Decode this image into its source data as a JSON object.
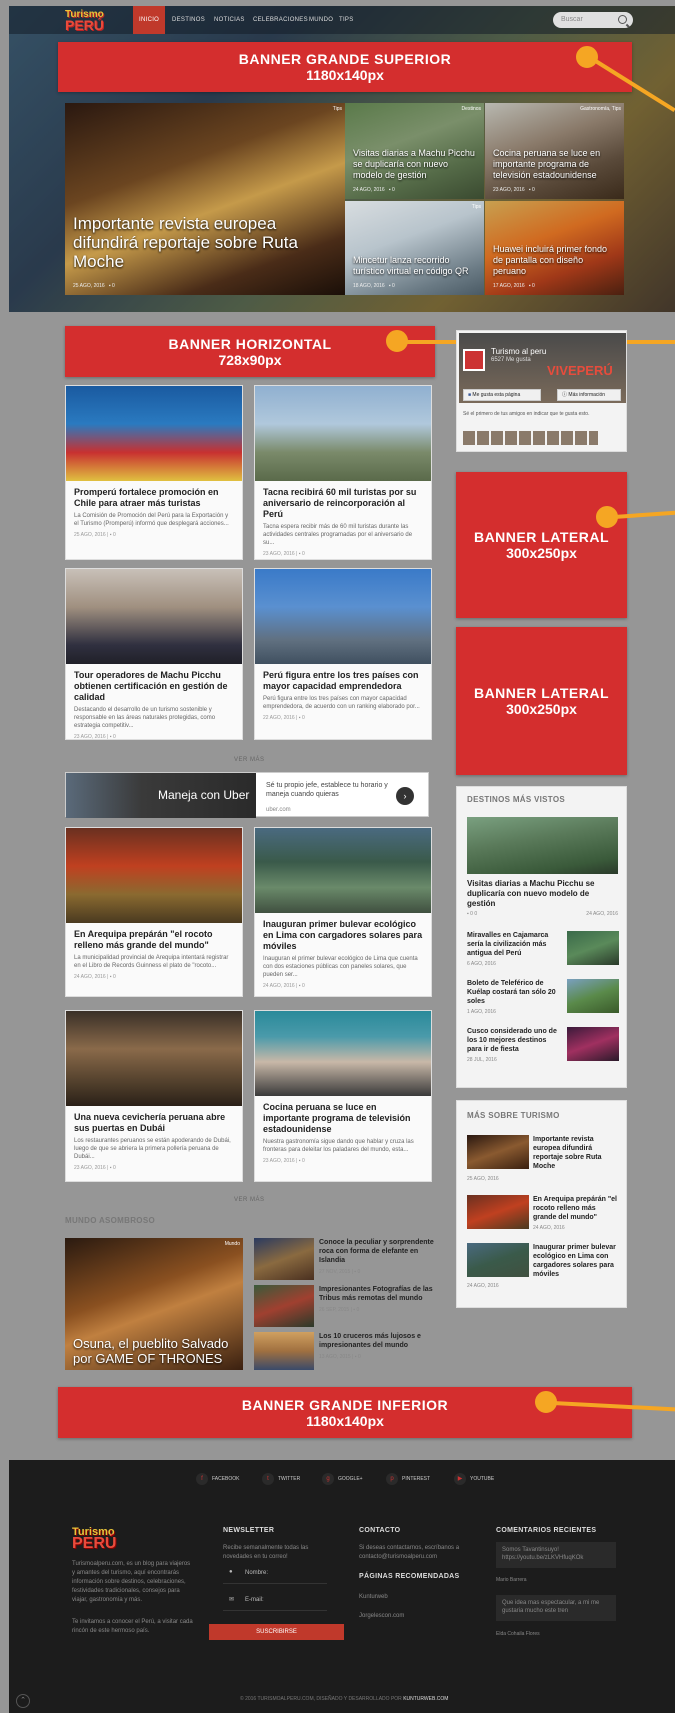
{
  "logo": {
    "line1": "Turismo",
    "line2": "PERÚ"
  },
  "nav": {
    "items": [
      "INICIO",
      "DESTINOS",
      "NOTICIAS",
      "CELEBRACIONES",
      "MUNDO",
      "TIPS"
    ],
    "search_placeholder": "Buscar"
  },
  "banners": {
    "top": {
      "l1": "BANNER  GRANDE SUPERIOR",
      "l2": "1180x140px"
    },
    "horizontal": {
      "l1": "BANNER  HORIZONTAL",
      "l2": "728x90px"
    },
    "lateral1": {
      "l1": "BANNER  LATERAL",
      "l2": "300x250px"
    },
    "lateral2": {
      "l1": "BANNER  LATERAL",
      "l2": "300x250px"
    },
    "bottom": {
      "l1": "BANNER  GRANDE INFERIOR",
      "l2": "1180x140px"
    }
  },
  "featured": [
    {
      "tag": "Tips",
      "title": "Importante revista europea difundirá reportaje sobre Ruta Moche",
      "date": "25 AGO, 2016",
      "comments": "0"
    },
    {
      "tag": "Destinos",
      "title": "Visitas diarias a Machu Picchu se duplicaría con nuevo modelo de gestión",
      "date": "24 AGO, 2016",
      "comments": "0"
    },
    {
      "tag": "Gastronomía, Tips",
      "title": "Cocina peruana se luce en importante programa de televisión estadounidense",
      "date": "23 AGO, 2016",
      "comments": "0"
    },
    {
      "tag": "Tips",
      "title": "Mincetur lanza recorrido turístico virtual en código QR",
      "date": "18 AGO, 2016",
      "comments": "0"
    },
    {
      "tag": "",
      "title": "Huawei incluirá primer fondo de pantalla con diseño peruano",
      "date": "17 AGO, 2016",
      "comments": "0"
    }
  ],
  "cards": [
    {
      "tag": "Noticias",
      "title": "Promperú fortalece promoción en Chile para atraer más turistas",
      "desc": "La Comisión de Promoción del Perú para la Exportación y el Turismo (Promperú) informó que desplegará acciones...",
      "date": "25 AGO, 2016",
      "comments": "0"
    },
    {
      "tag": "Noticias",
      "title": "Tacna recibirá 60 mil turistas por su aniversario de reincorporación al Perú",
      "desc": "Tacna espera recibir más de 60 mil turistas durante las actividades centrales programadas por el aniversario de su...",
      "date": "23 AGO, 2016",
      "comments": "0"
    },
    {
      "tag": "",
      "title": "Tour operadores de Machu Picchu obtienen certificación en gestión de calidad",
      "desc": "Destacando el desarrollo de un turismo sostenible y responsable en las áreas naturales protegidas, como estrategia competitiv...",
      "date": "23 AGO, 2016",
      "comments": "0"
    },
    {
      "tag": "Noticias",
      "title": "Perú figura entre los tres países con mayor capacidad emprendedora",
      "desc": "Perú figura entre los tres países con mayor capacidad emprendedora, de acuerdo con un ranking elaborado por...",
      "date": "22 AGO, 2016",
      "comments": "0"
    },
    {
      "tag": "Gastronomía",
      "title": "En Arequipa prepárán \"el rocoto relleno más grande del mundo\"",
      "desc": "La municipalidad provincial de Arequipa intentará registrar en el Libro de Records Guinness el plato de \"rocoto...",
      "date": "24 AGO, 2016",
      "comments": "0"
    },
    {
      "tag": "Noticias",
      "title": "Inauguran primer bulevar ecológico en Lima con cargadores solares para móviles",
      "desc": "Inauguran el primer bulevar ecológico de Lima que cuenta con dos estaciones públicas con paneles solares, que pueden ser...",
      "date": "24 AGO, 2016",
      "comments": "0"
    },
    {
      "tag": "",
      "title": "Una nueva cevichería peruana abre sus puertas en Dubái",
      "desc": "Los restaurantes peruanos se están apoderando de Dubái, luego de que se abriera la primera pollería peruana de Dubái...",
      "date": "23 AGO, 2016",
      "comments": "0"
    },
    {
      "tag": "Gastronomía, Tips",
      "title": "Cocina peruana se luce en importante programa de televisión estadounidense",
      "desc": "Nuestra gastronomía sigue dando que hablar y cruza las fronteras para deleitar los paladares del mundo, esta...",
      "date": "23 AGO, 2016",
      "comments": "0"
    }
  ],
  "ver_mas": "VER MÁS",
  "ad": {
    "title": "Maneja con Uber",
    "text": "Sé tu propio jefe, establece tu horario y maneja cuando quieras",
    "url": "uber.com"
  },
  "fb": {
    "name": "Turismo al peru",
    "likes": "6527 Me gusta",
    "like_btn": "Me gusta esta página",
    "info_btn": "Más información",
    "friends": "Sé el primero de tus amigos en indicar que te gusta esto.",
    "cover": "VIVEPERÚ"
  },
  "destinos": {
    "heading": "DESTINOS MÁS VISTOS",
    "main_title": "Visitas diarias a Machu Picchu se duplicaría con nuevo modelo de gestión",
    "main_meta": "0  0",
    "main_date": "24 AGO, 2016",
    "items": [
      {
        "title": "Miravalles en Cajamarca sería la civilización más antigua del Perú",
        "date": "6 AGO, 2016"
      },
      {
        "title": "Boleto de Teleférico de Kuélap costará tan sólo 20 soles",
        "date": "1 AGO, 2016"
      },
      {
        "title": "Cusco considerado uno de los 10 mejores destinos para ir de fiesta",
        "date": "28 JUL, 2016"
      }
    ]
  },
  "mas_turismo": {
    "heading": "MÁS SOBRE TURISMO",
    "items": [
      {
        "title": "Importante revista europea difundirá reportaje sobre Ruta Moche",
        "date": "25 AGO, 2016"
      },
      {
        "title": "En Arequipa prepárán \"el rocoto relleno más grande del mundo\"",
        "date": "24 AGO, 2016"
      },
      {
        "title": "Inaugurar primer bulevar ecológico en Lima con cargadores solares para móviles",
        "date": "24 AGO, 2016"
      }
    ]
  },
  "mundo": {
    "heading": "MUNDO ASOMBROSO",
    "main_tag": "Mundo",
    "main_title": "Osuna, el pueblito Salvado por GAME OF THRONES",
    "items": [
      {
        "title": "Conoce la peculiar y sorprendente roca con forma de elefante en Islandia",
        "date": "27 NOV, 2015",
        "comments": "0"
      },
      {
        "title": "Impresionantes Fotografías de las Tribus más remotas del mundo",
        "date": "26 SEP, 2015",
        "comments": "0"
      },
      {
        "title": "Los 10 cruceros más lujosos e impresionantes del mundo",
        "date": "13 AGO, 2015",
        "comments": "0"
      }
    ]
  },
  "footer": {
    "social": [
      "FACEBOOK",
      "TWITTER",
      "GOOGLE+",
      "PINTEREST",
      "YOUTUBE"
    ],
    "about": "Turismoalperu.com, es un blog para viajeros y amantes del turismo, aquí encontrarás información sobre destinos, celebraciones, festividades tradicionales, consejos para viajar, gastronomía y más.",
    "invite": "Te invitamos a conocer el Perú, a visitar cada rincón de este hermoso país.",
    "newsletter": {
      "heading": "NEWSLETTER",
      "text": "Recibe semanalmente todas las novedades en tu correo!",
      "name": "Nombre:",
      "email": "E-mail:",
      "button": "SUSCRIBIRSE"
    },
    "contacto": {
      "heading": "CONTACTO",
      "text": "Si deseas contactarnos, escríbanos a contacto@turismoalperu.com"
    },
    "paginas": {
      "heading": "PÁGINAS RECOMENDADAS",
      "items": [
        "Kunturweb",
        "Jorgelescon.com"
      ]
    },
    "comentarios": {
      "heading": "COMENTARIOS RECIENTES",
      "items": [
        {
          "text": "Somos Tavantinsuyo! https://youtu.be/zLKVHfuqKOk",
          "author": "Mario Barrera"
        },
        {
          "text": "Que idea mas espectacular, a mi me gustaria mucho este tren",
          "author": "Elda Cohaila Flores"
        }
      ]
    },
    "copyright": "© 2016 TURISMOALPERU.COM, DISEÑADO Y DESARROLLADO POR",
    "copyright_link": "KUNTURWEB.COM"
  },
  "colors": {
    "accent": "#d42e2e",
    "pointer": "#f5a623",
    "footer": "#1c1c1c"
  }
}
